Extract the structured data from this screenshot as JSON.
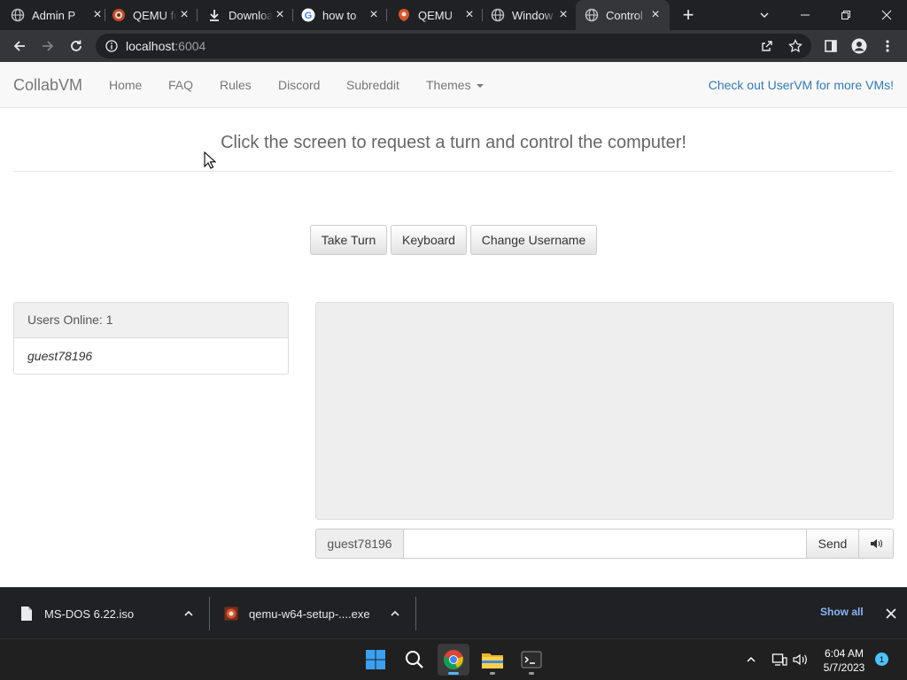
{
  "browser": {
    "tabs": [
      {
        "title": "Admin P",
        "icon": "globe-icon"
      },
      {
        "title": "QEMU fo",
        "icon": "qemu-icon"
      },
      {
        "title": "Downloa",
        "icon": "download-icon"
      },
      {
        "title": "how to",
        "icon": "google-icon"
      },
      {
        "title": "QEMU",
        "icon": "qemu-icon"
      },
      {
        "title": "Window",
        "icon": "globe-icon"
      },
      {
        "title": "Control",
        "icon": "globe-icon",
        "active": true
      }
    ],
    "url_host": "localhost",
    "url_port": ":6004"
  },
  "navbar": {
    "brand": "CollabVM",
    "links": [
      "Home",
      "FAQ",
      "Rules",
      "Discord",
      "Subreddit",
      "Themes"
    ],
    "right_link": "Check out UserVM for more VMs!"
  },
  "main": {
    "headline": "Click the screen to request a turn and control the computer!",
    "buttons": {
      "take_turn": "Take Turn",
      "keyboard": "Keyboard",
      "change_username": "Change Username"
    }
  },
  "users": {
    "header": "Users Online: 1",
    "list": [
      "guest78196"
    ]
  },
  "chat": {
    "username": "guest78196",
    "input_value": "",
    "send_label": "Send"
  },
  "downloads": {
    "items": [
      {
        "name": "MS-DOS 6.22.iso",
        "icon": "file-icon"
      },
      {
        "name": "qemu-w64-setup-....exe",
        "icon": "qemu-icon"
      }
    ],
    "show_all": "Show all"
  },
  "taskbar": {
    "time": "6:04 AM",
    "date": "5/7/2023",
    "notifications": "1"
  },
  "colors": {
    "chrome_dark": "#202124",
    "chrome_toolbar": "#35363a",
    "link_blue": "#337ab7",
    "accent_blue": "#8ab4f8"
  }
}
